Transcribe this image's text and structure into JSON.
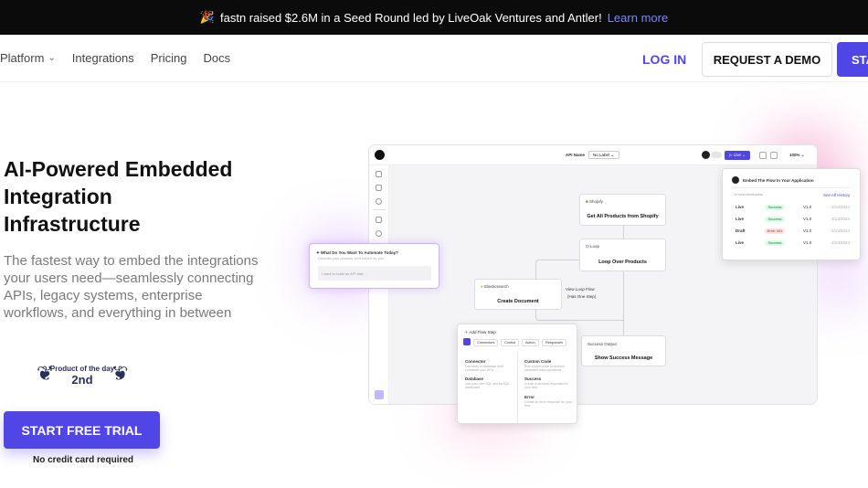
{
  "banner": {
    "party_icon": "party-popper-icon",
    "text": "fastn raised $2.6M in a Seed Round led by LiveOak Ventures and Antler!",
    "link": "Learn more"
  },
  "nav": {
    "items": [
      "Platform",
      "Integrations",
      "Pricing",
      "Docs"
    ],
    "login": "LOG IN",
    "request_demo": "REQUEST A DEMO",
    "start": "STA"
  },
  "hero": {
    "title_lines": [
      "AI-Powered Embedded",
      "Integration",
      "Infrastructure"
    ],
    "subtitle_lines": [
      "The fastest way to embed the integrations",
      "your users need—seamlessly connecting",
      "APIs, legacy systems, enterprise",
      "workflows, and everything in between"
    ],
    "award_line1": "Product of the day",
    "award_line2": "2nd",
    "cta": "START FREE TRIAL",
    "cta_note": "No credit card required"
  },
  "app": {
    "api_name_label": "API Name",
    "no_label": "No Label",
    "live": "Live",
    "zoom": "100%",
    "prompt_title": "What Do You Want To Automate Today?",
    "prompt_sub": "Describe your process, we'll build it for you",
    "prompt_placeholder": "I want to build an API that...",
    "nodes": {
      "shopify_tag": "Shopify",
      "shopify_name": "Get All Products from Shopify",
      "loop_tag": "Loop",
      "loop_name": "Loop Over Products",
      "es_tag": "Elasticsearch",
      "es_name": "Create Document",
      "view_loop": "View Loop Flow",
      "view_loop_sub": "(Has One Step)",
      "success_tag": "Success Output",
      "success_name": "Show Success Message"
    },
    "add_step": {
      "title": "Add Flow Step",
      "tabs": [
        "Connectors",
        "Control",
        "Action",
        "Responses"
      ],
      "items": [
        {
          "name": "Connector",
          "desc": "Use fastn or database stuff connector your APIs"
        },
        {
          "name": "Custom Code",
          "desc": "Run custom code to perform advanced data operations"
        },
        {
          "name": "Database",
          "desc": "Use your own SQL and NoSQL databases"
        },
        {
          "name": "Success",
          "desc": "Create a success response for your flow"
        },
        {
          "name": "Error",
          "desc": "Create an error response for your flow"
        }
      ]
    },
    "embed": {
      "title": "Embed The Flow In Your Application",
      "subtitle": "10 new developers",
      "see_all": "See All History",
      "rows": [
        {
          "env": "Live",
          "status": "Success",
          "ver": "V1.0",
          "date": "2/13/2024"
        },
        {
          "env": "Live",
          "status": "Success",
          "ver": "V1.0",
          "date": "2/13/2024"
        },
        {
          "env": "Draft",
          "status": "Error 401",
          "ver": "V1.0",
          "date": "2/13/2024"
        },
        {
          "env": "Live",
          "status": "Success",
          "ver": "V1.0",
          "date": "2/13/2024"
        }
      ]
    }
  },
  "colors": {
    "brand": "#5046e5",
    "banner_bg": "#0b0b0b",
    "success": "#22c55e",
    "error": "#ef4444"
  }
}
